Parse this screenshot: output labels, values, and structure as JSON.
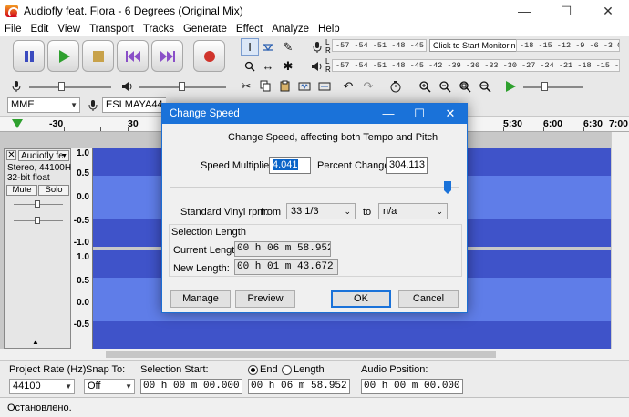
{
  "window": {
    "title": "Audiofly feat. Fiora - 6 Degrees (Original Mix)",
    "minimize_glyph": "—",
    "maximize_glyph": "☐",
    "close_glyph": "✕"
  },
  "menu": [
    "File",
    "Edit",
    "View",
    "Transport",
    "Tracks",
    "Generate",
    "Effect",
    "Analyze",
    "Help"
  ],
  "meters": {
    "record_scale": "-57 -54 -51 -48 -45 -42 -3",
    "record_tip": "Click to Start Monitoring",
    "record_scale_right": "-18 -15 -12 -9 -6 -3 0",
    "playback_scale": "-57 -54 -51 -48 -45 -42 -39 -36 -33 -30 -27 -24 -21 -18 -15 -12 -9 -6 -3 0",
    "channel_l": "L",
    "channel_r": "R"
  },
  "device": {
    "host": "MME",
    "recording_device": "ESI MAYA44 XTe"
  },
  "timeline": [
    "-30",
    "30",
    "5:30",
    "6:00",
    "6:30",
    "7:00"
  ],
  "track": {
    "name": "Audiofly fe",
    "close_glyph": "✕",
    "menu_glyph": "▼",
    "info_line1": "Stereo, 44100Hz",
    "info_line2": "32-bit float",
    "mute_label": "Mute",
    "solo_label": "Solo",
    "ruler_top": [
      "1.0",
      "0.5",
      "0.0",
      "-0.5",
      "-1.0"
    ],
    "ruler_bottom": [
      "1.0",
      "0.5",
      "0.0",
      "-0.5"
    ]
  },
  "dialog": {
    "title": "Change Speed",
    "heading": "Change Speed, affecting both Tempo and Pitch",
    "speed_multiplier_label": "Speed Multiplier:",
    "speed_multiplier_value": "4.041",
    "percent_change_label": "Percent Change:",
    "percent_change_value": "304.113",
    "slider_fraction": 0.96,
    "vinyl_label": "Standard Vinyl rpm:",
    "from_label": "from",
    "from_value": "33 1/3",
    "to_label": "to",
    "to_value": "n/a",
    "selection_length_label": "Selection Length",
    "current_length_label": "Current Length:",
    "current_length_value": "00 h 06 m 58.952 s",
    "new_length_label": "New Length:",
    "new_length_value": "00 h 01 m 43.672 s",
    "manage_label": "Manage",
    "preview_label": "Preview",
    "ok_label": "OK",
    "cancel_label": "Cancel"
  },
  "selection_toolbar": {
    "project_rate_label": "Project Rate (Hz):",
    "project_rate_value": "44100",
    "snap_to_label": "Snap To:",
    "snap_to_value": "Off",
    "selection_start_label": "Selection Start:",
    "selection_start_value": "00 h 00 m 00.000 s",
    "end_label": "End",
    "length_label": "Length",
    "end_value": "00 h 06 m 58.952 s",
    "audio_position_label": "Audio Position:",
    "audio_position_value": "00 h 00 m 00.000 s"
  },
  "status": "Остановлено.",
  "colors": {
    "waveform_outer": "#3f53c9",
    "waveform_inner": "#5f7de8",
    "dialog_titlebar": "#1a72d9"
  }
}
